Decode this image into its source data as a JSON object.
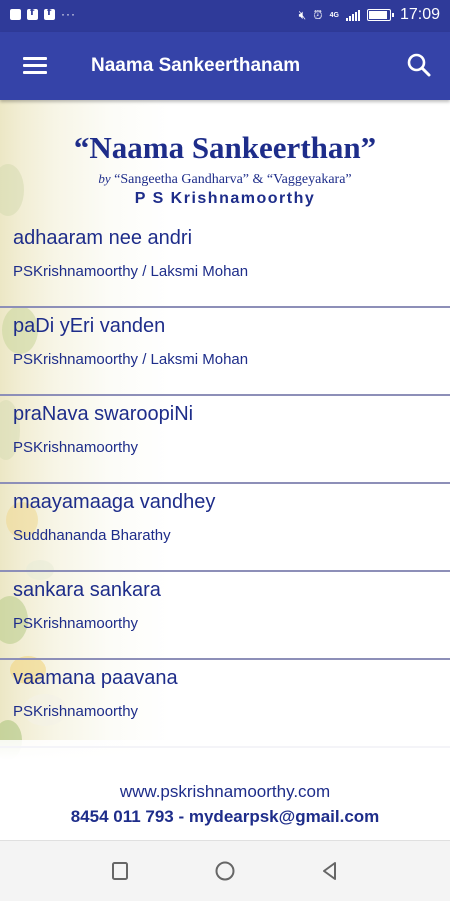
{
  "status_bar": {
    "notification_icons": [
      "photo-icon",
      "facebook-icon",
      "facebook-icon"
    ],
    "more_indicator": "···",
    "network": "4G",
    "time": "17:09"
  },
  "app_bar": {
    "title": "Naama Sankeerthanam"
  },
  "banner": {
    "title": "“Naama Sankeerthan”",
    "by": "by",
    "by_line": "“Sangeetha Gandharva” & “Vaggeyakara”",
    "author": "P S Krishnamoorthy"
  },
  "songs": [
    {
      "title": "adhaaram nee andri",
      "author": "PSKrishnamoorthy / Laksmi Mohan"
    },
    {
      "title": "paDi yEri vanden",
      "author": "PSKrishnamoorthy / Laksmi Mohan"
    },
    {
      "title": "praNava swaroopiNi",
      "author": "PSKrishnamoorthy"
    },
    {
      "title": "maayamaaga vandhey",
      "author": "Suddhananda Bharathy"
    },
    {
      "title": "sankara sankara",
      "author": "PSKrishnamoorthy"
    },
    {
      "title": "vaamana paavana",
      "author": "PSKrishnamoorthy"
    }
  ],
  "footer": {
    "website": "www.pskrishnamoorthy.com",
    "contact": "8454 011 793 - mydearpsk@gmail.com"
  },
  "nav_bar": {
    "buttons": [
      "recents-icon",
      "home-icon",
      "back-icon"
    ]
  },
  "colors": {
    "app_bar": "#3543a8",
    "status_bar": "#2f3a99",
    "text_blue": "#1e2d8a"
  }
}
